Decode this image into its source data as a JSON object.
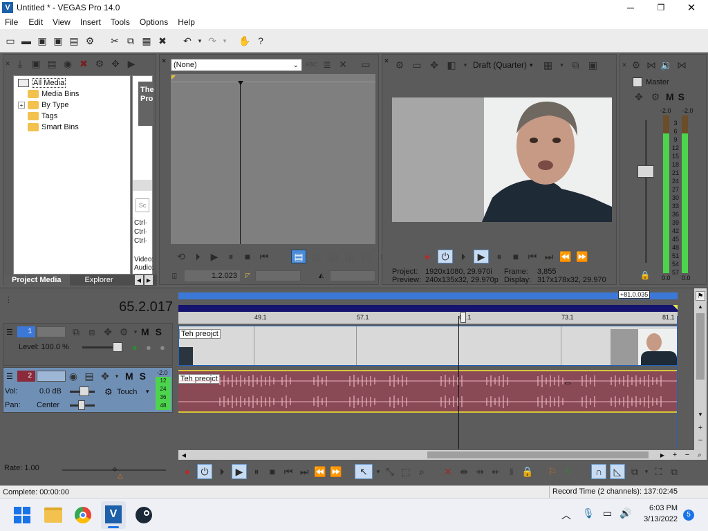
{
  "window": {
    "title": "Untitled * - VEGAS Pro 14.0"
  },
  "menu": [
    "File",
    "Edit",
    "View",
    "Insert",
    "Tools",
    "Options",
    "Help"
  ],
  "project_media": {
    "tree": [
      {
        "label": "All Media"
      },
      {
        "label": "Media Bins"
      },
      {
        "label": "By Type",
        "expander": "+"
      },
      {
        "label": "Tags"
      },
      {
        "label": "Smart Bins"
      }
    ],
    "thumb_text": "The Pro",
    "ctrl_lines": [
      "Ctrl·",
      "Ctrl·",
      "Ctrl·"
    ],
    "side_labels": [
      "Video:",
      "Audio:"
    ],
    "tabs": [
      "Project Media",
      "Explorer"
    ]
  },
  "trimmer": {
    "dropdown": "(None)",
    "abc": "ABC",
    "timecode": "1.2.023"
  },
  "preview": {
    "quality": "Draft (Quarter)",
    "project_label": "Project:",
    "project_value": "1920x1080, 29.970i",
    "frame_label": "Frame:",
    "frame_value": "3,855",
    "preview_label": "Preview:",
    "preview_value": "240x135x32, 29.970p",
    "display_label": "Display:",
    "display_value": "317x178x32, 29.970"
  },
  "master": {
    "title": "Master",
    "m": "M",
    "s": "S",
    "peak_left": "-2.0",
    "peak_right": "-2.0",
    "scale": [
      "3",
      "6",
      "9",
      "12",
      "15",
      "18",
      "21",
      "24",
      "27",
      "30",
      "33",
      "36",
      "39",
      "42",
      "45",
      "48",
      "51",
      "54",
      "57"
    ],
    "bottom_left": "0.0",
    "bottom_right": "0.0"
  },
  "timeline": {
    "cursor_time": "65.2.017",
    "end_marker": "+81.0.035",
    "ruler": [
      "49.1",
      "57.1",
      "65.1",
      "73.1",
      "81.1"
    ],
    "video_track": {
      "number": "1",
      "level": "Level: 100.0 %",
      "m": "M",
      "s": "S",
      "clip_label": "Teh preojct"
    },
    "audio_track": {
      "number": "2",
      "m": "M",
      "s": "S",
      "vol_label": "Vol:",
      "vol_value": "0.0 dB",
      "pan_label": "Pan:",
      "pan_value": "Center",
      "automation": "Touch",
      "meter_peak": "-2.0",
      "meter_scale": [
        "12",
        "24",
        "36",
        "48"
      ],
      "clip_label": "Teh preojct"
    },
    "rate": "Rate: 1.00"
  },
  "status": {
    "left": "Complete: 00:00:00",
    "right": "Record Time (2 channels): 137:02:45"
  },
  "taskbar": {
    "time": "6:03 PM",
    "date": "3/13/2022",
    "notifications": "5"
  },
  "colors": {
    "accent_blue": "#3c78d8",
    "audio_clip": "#8a4a55",
    "waveform": "#e8b3bf",
    "video_clip": "#d9d9d9",
    "meter_green": "#4cd44c",
    "meter_yellow": "#e6e64c"
  }
}
